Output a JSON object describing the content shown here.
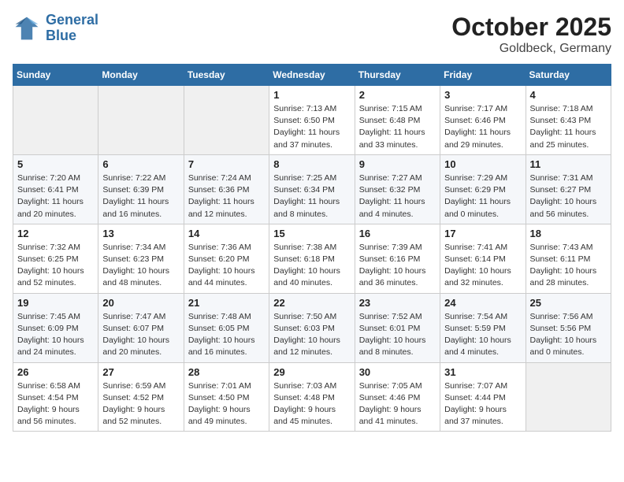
{
  "logo": {
    "line1": "General",
    "line2": "Blue"
  },
  "title": "October 2025",
  "location": "Goldbeck, Germany",
  "days_header": [
    "Sunday",
    "Monday",
    "Tuesday",
    "Wednesday",
    "Thursday",
    "Friday",
    "Saturday"
  ],
  "weeks": [
    [
      {
        "num": "",
        "detail": ""
      },
      {
        "num": "",
        "detail": ""
      },
      {
        "num": "",
        "detail": ""
      },
      {
        "num": "1",
        "detail": "Sunrise: 7:13 AM\nSunset: 6:50 PM\nDaylight: 11 hours and 37 minutes."
      },
      {
        "num": "2",
        "detail": "Sunrise: 7:15 AM\nSunset: 6:48 PM\nDaylight: 11 hours and 33 minutes."
      },
      {
        "num": "3",
        "detail": "Sunrise: 7:17 AM\nSunset: 6:46 PM\nDaylight: 11 hours and 29 minutes."
      },
      {
        "num": "4",
        "detail": "Sunrise: 7:18 AM\nSunset: 6:43 PM\nDaylight: 11 hours and 25 minutes."
      }
    ],
    [
      {
        "num": "5",
        "detail": "Sunrise: 7:20 AM\nSunset: 6:41 PM\nDaylight: 11 hours and 20 minutes."
      },
      {
        "num": "6",
        "detail": "Sunrise: 7:22 AM\nSunset: 6:39 PM\nDaylight: 11 hours and 16 minutes."
      },
      {
        "num": "7",
        "detail": "Sunrise: 7:24 AM\nSunset: 6:36 PM\nDaylight: 11 hours and 12 minutes."
      },
      {
        "num": "8",
        "detail": "Sunrise: 7:25 AM\nSunset: 6:34 PM\nDaylight: 11 hours and 8 minutes."
      },
      {
        "num": "9",
        "detail": "Sunrise: 7:27 AM\nSunset: 6:32 PM\nDaylight: 11 hours and 4 minutes."
      },
      {
        "num": "10",
        "detail": "Sunrise: 7:29 AM\nSunset: 6:29 PM\nDaylight: 11 hours and 0 minutes."
      },
      {
        "num": "11",
        "detail": "Sunrise: 7:31 AM\nSunset: 6:27 PM\nDaylight: 10 hours and 56 minutes."
      }
    ],
    [
      {
        "num": "12",
        "detail": "Sunrise: 7:32 AM\nSunset: 6:25 PM\nDaylight: 10 hours and 52 minutes."
      },
      {
        "num": "13",
        "detail": "Sunrise: 7:34 AM\nSunset: 6:23 PM\nDaylight: 10 hours and 48 minutes."
      },
      {
        "num": "14",
        "detail": "Sunrise: 7:36 AM\nSunset: 6:20 PM\nDaylight: 10 hours and 44 minutes."
      },
      {
        "num": "15",
        "detail": "Sunrise: 7:38 AM\nSunset: 6:18 PM\nDaylight: 10 hours and 40 minutes."
      },
      {
        "num": "16",
        "detail": "Sunrise: 7:39 AM\nSunset: 6:16 PM\nDaylight: 10 hours and 36 minutes."
      },
      {
        "num": "17",
        "detail": "Sunrise: 7:41 AM\nSunset: 6:14 PM\nDaylight: 10 hours and 32 minutes."
      },
      {
        "num": "18",
        "detail": "Sunrise: 7:43 AM\nSunset: 6:11 PM\nDaylight: 10 hours and 28 minutes."
      }
    ],
    [
      {
        "num": "19",
        "detail": "Sunrise: 7:45 AM\nSunset: 6:09 PM\nDaylight: 10 hours and 24 minutes."
      },
      {
        "num": "20",
        "detail": "Sunrise: 7:47 AM\nSunset: 6:07 PM\nDaylight: 10 hours and 20 minutes."
      },
      {
        "num": "21",
        "detail": "Sunrise: 7:48 AM\nSunset: 6:05 PM\nDaylight: 10 hours and 16 minutes."
      },
      {
        "num": "22",
        "detail": "Sunrise: 7:50 AM\nSunset: 6:03 PM\nDaylight: 10 hours and 12 minutes."
      },
      {
        "num": "23",
        "detail": "Sunrise: 7:52 AM\nSunset: 6:01 PM\nDaylight: 10 hours and 8 minutes."
      },
      {
        "num": "24",
        "detail": "Sunrise: 7:54 AM\nSunset: 5:59 PM\nDaylight: 10 hours and 4 minutes."
      },
      {
        "num": "25",
        "detail": "Sunrise: 7:56 AM\nSunset: 5:56 PM\nDaylight: 10 hours and 0 minutes."
      }
    ],
    [
      {
        "num": "26",
        "detail": "Sunrise: 6:58 AM\nSunset: 4:54 PM\nDaylight: 9 hours and 56 minutes."
      },
      {
        "num": "27",
        "detail": "Sunrise: 6:59 AM\nSunset: 4:52 PM\nDaylight: 9 hours and 52 minutes."
      },
      {
        "num": "28",
        "detail": "Sunrise: 7:01 AM\nSunset: 4:50 PM\nDaylight: 9 hours and 49 minutes."
      },
      {
        "num": "29",
        "detail": "Sunrise: 7:03 AM\nSunset: 4:48 PM\nDaylight: 9 hours and 45 minutes."
      },
      {
        "num": "30",
        "detail": "Sunrise: 7:05 AM\nSunset: 4:46 PM\nDaylight: 9 hours and 41 minutes."
      },
      {
        "num": "31",
        "detail": "Sunrise: 7:07 AM\nSunset: 4:44 PM\nDaylight: 9 hours and 37 minutes."
      },
      {
        "num": "",
        "detail": ""
      }
    ]
  ]
}
